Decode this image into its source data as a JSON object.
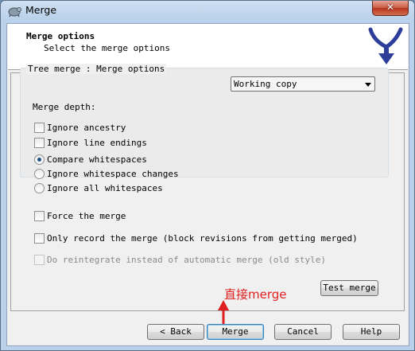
{
  "window": {
    "title": "Merge",
    "close_glyph": "✕"
  },
  "header": {
    "title": "Merge options",
    "subtitle": "Select the merge options"
  },
  "tree_merge": {
    "group_title": "Tree merge : Merge options",
    "merge_depth_label": "Merge depth:",
    "merge_depth_value": "Working copy",
    "ignore_ancestry": {
      "label": "Ignore ancestry",
      "checked": false
    },
    "ignore_line_endings": {
      "label": "Ignore line endings",
      "checked": false
    },
    "whitespace_options": [
      {
        "label": "Compare whitespaces",
        "checked": true
      },
      {
        "label": "Ignore whitespace changes",
        "checked": false
      },
      {
        "label": "Ignore all whitespaces",
        "checked": false
      }
    ]
  },
  "options": {
    "force_merge": {
      "label": "Force the merge",
      "checked": false
    },
    "only_record": {
      "label": "Only record the merge (block revisions from getting merged)",
      "checked": false
    },
    "reintegrate": {
      "label": "Do reintegrate instead of automatic merge (old style)",
      "checked": false,
      "enabled": false
    }
  },
  "buttons": {
    "test_merge": "Test merge",
    "back": "< Back",
    "merge": "Merge",
    "cancel": "Cancel",
    "help": "Help"
  },
  "annotation": {
    "text": "直接merge",
    "color": "#e02020"
  },
  "icons": {
    "app": "tortoise-merge-icon",
    "logo": "merge-branch-logo",
    "close": "close-icon"
  }
}
